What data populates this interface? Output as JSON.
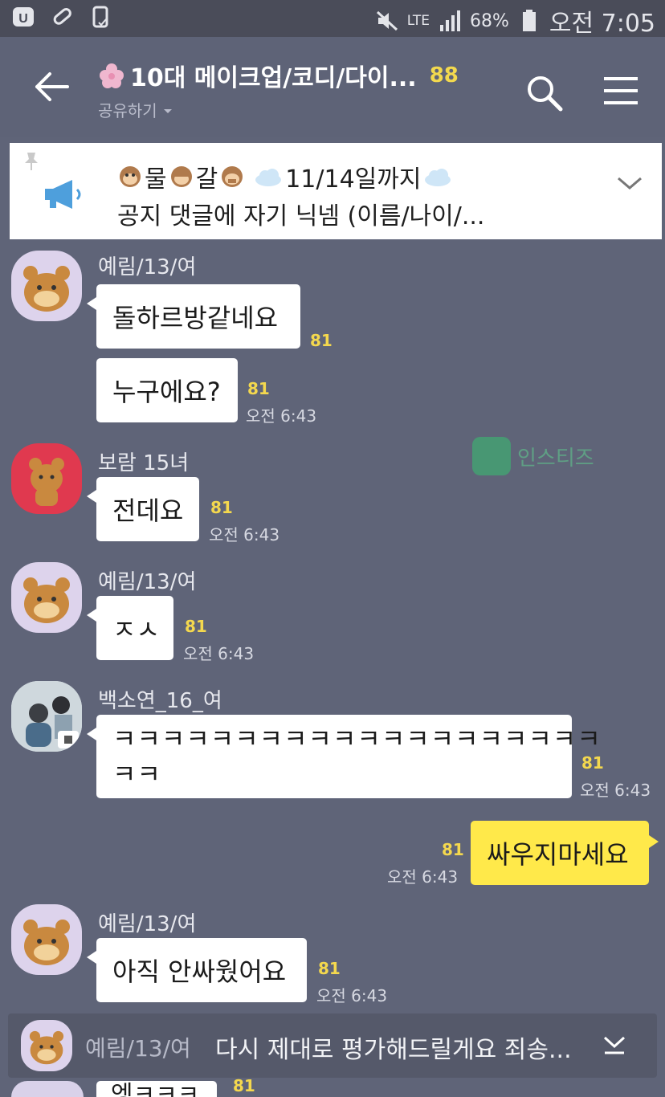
{
  "status_bar": {
    "network": "LTE",
    "battery": "68%",
    "time": "오전 7:05"
  },
  "header": {
    "title": "10대 메이크업/코디/다이...",
    "member_count": "88",
    "subtitle": "공유하기",
    "icons": [
      "back-arrow-icon",
      "search-icon",
      "menu-icon"
    ]
  },
  "notice": {
    "line1_word1": "물",
    "line1_word2": "갈",
    "line1_date": "11/14일까지",
    "line2": "공지 댓글에 자기 닉넴 (이름/나이/..."
  },
  "messages": [
    {
      "sender": "예림/13/여",
      "text": "돌하르방같네요",
      "unread": "81",
      "time": ""
    },
    {
      "sender": "",
      "text": "누구에요?",
      "unread": "81",
      "time": "오전 6:43"
    },
    {
      "sender": "보람 15녀",
      "text": "전데요",
      "unread": "81",
      "time": "오전 6:43"
    },
    {
      "sender": "예림/13/여",
      "text": "ㅈㅅ",
      "unread": "81",
      "time": "오전 6:43"
    },
    {
      "sender": "백소연_16_여",
      "text_line1": "ㅋㅋㅋㅋㅋㅋㅋㅋㅋㅋㅋㅋㅋㅋㅋㅋㅋㅋㅋㅋ",
      "text_line2": "ㅋㅋ",
      "unread": "81",
      "time": "오전 6:43"
    },
    {
      "sender": "me",
      "text": "싸우지마세요",
      "unread": "81",
      "time": "오전 6:43"
    },
    {
      "sender": "예림/13/여",
      "text": "아직 안싸웠어요",
      "unread": "81",
      "time": "오전 6:43"
    }
  ],
  "watermark": "인스티즈",
  "preview_bar": {
    "sender": "예림/13/여",
    "text": "다시 제대로 평가해드릴게요 죄송..."
  },
  "partial_message": {
    "text": "엥ㅋㅋㅋ",
    "unread": "81"
  },
  "colors": {
    "background": "#5f6478",
    "my_bubble": "#ffe94a",
    "unread": "#f4d84e"
  }
}
